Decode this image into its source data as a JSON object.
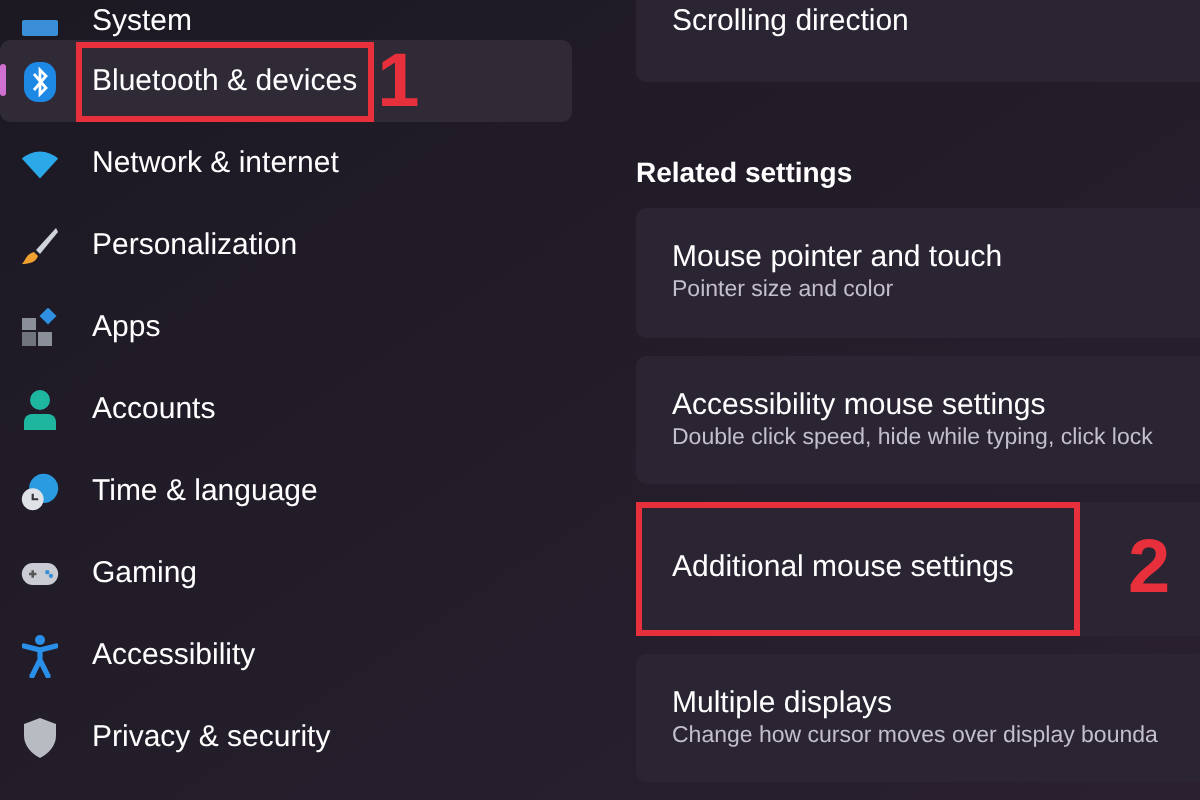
{
  "sidebar": {
    "items": [
      {
        "label": "System",
        "selected": false
      },
      {
        "label": "Bluetooth & devices",
        "selected": true
      },
      {
        "label": "Network & internet",
        "selected": false
      },
      {
        "label": "Personalization",
        "selected": false
      },
      {
        "label": "Apps",
        "selected": false
      },
      {
        "label": "Accounts",
        "selected": false
      },
      {
        "label": "Time & language",
        "selected": false
      },
      {
        "label": "Gaming",
        "selected": false
      },
      {
        "label": "Accessibility",
        "selected": false
      },
      {
        "label": "Privacy & security",
        "selected": false
      }
    ]
  },
  "content": {
    "top_card": {
      "title": "Scrolling direction"
    },
    "section_title": "Related settings",
    "cards": [
      {
        "title": "Mouse pointer and touch",
        "subtitle": "Pointer size and color",
        "highlighted": false
      },
      {
        "title": "Accessibility mouse settings",
        "subtitle": "Double click speed, hide while typing, click lock",
        "highlighted": false
      },
      {
        "title": "Additional mouse settings",
        "highlighted": true
      },
      {
        "title": "Multiple displays",
        "subtitle": "Change how cursor moves over display bounda",
        "highlighted": false
      }
    ]
  },
  "annotations": [
    {
      "label": "1"
    },
    {
      "label": "2"
    }
  ]
}
